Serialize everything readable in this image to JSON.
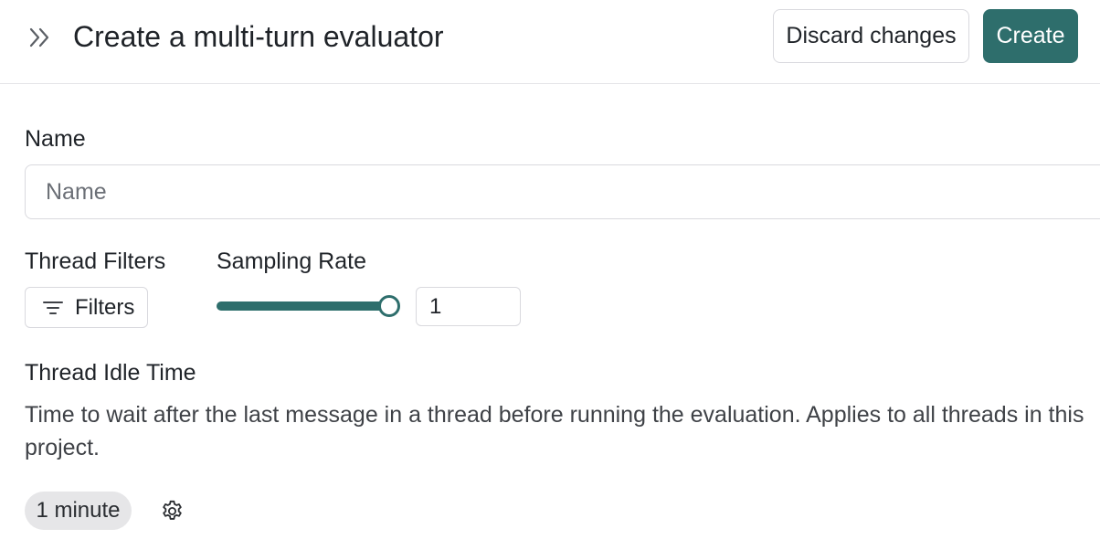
{
  "header": {
    "title": "Create a multi-turn evaluator",
    "collapse_icon": "double-chevron-right-icon",
    "discard_label": "Discard changes",
    "create_label": "Create"
  },
  "name_field": {
    "label": "Name",
    "placeholder": "Name",
    "value": ""
  },
  "thread_filters": {
    "label": "Thread Filters",
    "button_label": "Filters",
    "icon": "filter-lines-icon"
  },
  "sampling_rate": {
    "label": "Sampling Rate",
    "slider_value": 1,
    "slider_min": 0,
    "slider_max": 1,
    "input_value": "1"
  },
  "thread_idle_time": {
    "label": "Thread Idle Time",
    "description": "Time to wait after the last message in a thread before running the evaluation. Applies to all threads in this project.",
    "value_pill": "1 minute",
    "settings_icon": "gear-icon"
  },
  "colors": {
    "accent": "#2e6e6c",
    "border": "#d9d9de",
    "pill_bg": "#e6e6e8"
  }
}
